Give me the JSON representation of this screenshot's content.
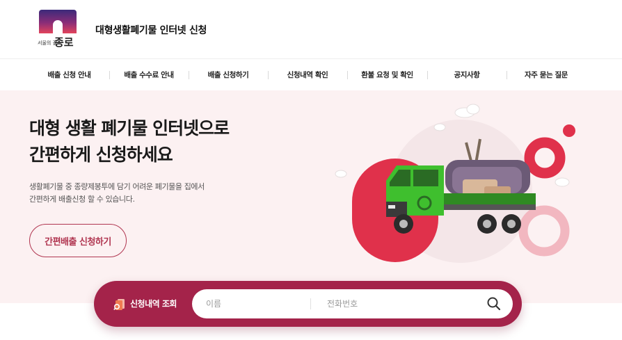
{
  "header": {
    "logo_small": "서울의 길",
    "logo_big": "종로",
    "site_title": "대형생활폐기물 인터넷 신청"
  },
  "nav": {
    "items": [
      {
        "label": "배출 신청 안내"
      },
      {
        "label": "배출 수수료 안내"
      },
      {
        "label": "배출 신청하기"
      },
      {
        "label": "신청내역 확인"
      },
      {
        "label": "환불 요청 및 확인"
      },
      {
        "label": "공지사항"
      },
      {
        "label": "자주 묻는 질문"
      }
    ]
  },
  "hero": {
    "title_line1": "대형 생활 폐기물 인터넷으로",
    "title_line2": "간편하게 신청하세요",
    "desc_line1": "생활폐기물 중 종량제봉투에 담기 어려운 폐기물을 집에서",
    "desc_line2": "간편하게 배출신청 할 수 있습니다.",
    "apply_button": "간편배출 신청하기"
  },
  "search": {
    "label": "신청내역 조회",
    "name_placeholder": "이름",
    "phone_placeholder": "전화번호",
    "icon": "search-icon"
  },
  "colors": {
    "brand": "#a4234a",
    "hero_bg": "#fcf1f2",
    "accent_red": "#e0314b",
    "truck_green": "#3fbf2e"
  }
}
